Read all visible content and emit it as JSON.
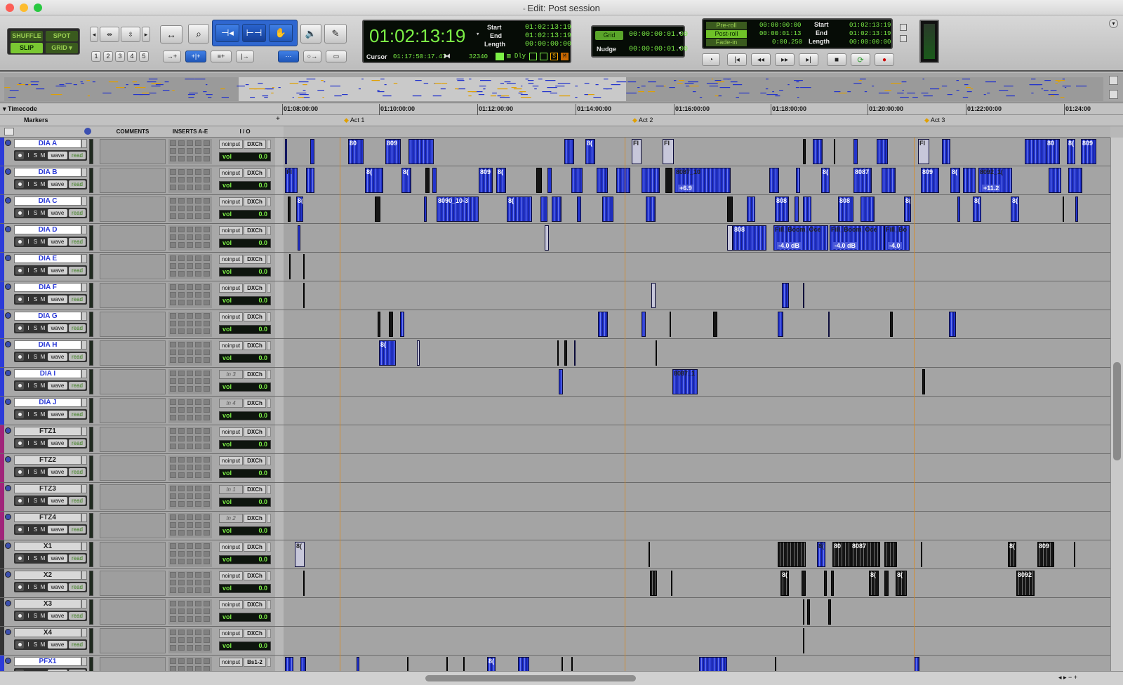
{
  "window": {
    "title": "Edit: Post session"
  },
  "toolbar": {
    "modes": [
      "SHUFFLE",
      "SPOT",
      "SLIP",
      "GRID"
    ],
    "zoom_presets": [
      "1",
      "2",
      "3",
      "4",
      "5"
    ],
    "counter": {
      "main": "01:02:13:19",
      "start_label": "Start",
      "end_label": "End",
      "length_label": "Length",
      "start": "01:02:13:19",
      "end": "01:02:13:19",
      "length": "00:00:00:00",
      "cursor_label": "Cursor",
      "cursor": "01:17:50:17.47",
      "samples": "32340",
      "dly": "Dly"
    },
    "grid": {
      "grid_label": "Grid",
      "grid_value": "00:00:00:01.00",
      "nudge_label": "Nudge",
      "nudge_value": "00:00:00:01.00"
    },
    "transport_lcd": {
      "preroll_label": "Pre-roll",
      "preroll": "00:00:00:00",
      "postroll_label": "Post-roll",
      "postroll": "00:00:01:13",
      "fadein_label": "Fade-in",
      "fadein": "0:00.250",
      "start_label": "Start",
      "start": "01:02:13:19",
      "end_label": "End",
      "end": "01:02:13:19",
      "length_label": "Length",
      "length": "00:00:00:00"
    }
  },
  "rulers": {
    "timecode_label": "Timecode",
    "markers_label": "Markers",
    "ticks": [
      "01:08:00:00",
      "01:10:00:00",
      "01:12:00:00",
      "01:14:00:00",
      "01:16:00:00",
      "01:18:00:00",
      "01:20:00:00",
      "01:22:00:00",
      "01:24:00"
    ],
    "markers": [
      "Act 1",
      "Act 2",
      "Act 3"
    ]
  },
  "columns": {
    "comments": "COMMENTS",
    "inserts": "INSERTS A-E",
    "io": "I / O"
  },
  "track_buttons": {
    "i": "I",
    "s": "S",
    "m": "M",
    "wave": "wave",
    "read": "read",
    "vol": "vol"
  },
  "tracks": [
    {
      "name": "DIA A",
      "input": "noinput",
      "output": "DXCh",
      "vol": "0.0",
      "color": "#2c3bd8"
    },
    {
      "name": "DIA B",
      "input": "noinput",
      "output": "DXCh",
      "vol": "0.0",
      "color": "#2c3bd8"
    },
    {
      "name": "DIA C",
      "input": "noinput",
      "output": "DXCh",
      "vol": "0.0",
      "color": "#2c3bd8"
    },
    {
      "name": "DIA D",
      "input": "noinput",
      "output": "DXCh",
      "vol": "0.0",
      "color": "#2c3bd8"
    },
    {
      "name": "DIA E",
      "input": "noinput",
      "output": "DXCh",
      "vol": "0.0",
      "color": "#2c3bd8"
    },
    {
      "name": "DIA F",
      "input": "noinput",
      "output": "DXCh",
      "vol": "0.0",
      "color": "#2c3bd8"
    },
    {
      "name": "DIA G",
      "input": "noinput",
      "output": "DXCh",
      "vol": "0.0",
      "color": "#2c3bd8"
    },
    {
      "name": "DIA H",
      "input": "noinput",
      "output": "DXCh",
      "vol": "0.0",
      "color": "#2c3bd8"
    },
    {
      "name": "DIA I",
      "input": "In 3",
      "output": "DXCh",
      "vol": "0.0",
      "color": "#2c3bd8"
    },
    {
      "name": "DIA J",
      "input": "In 4",
      "output": "DXCh",
      "vol": "0.0",
      "color": "#2c3bd8"
    },
    {
      "name": "FTZ1",
      "input": "noinput",
      "output": "DXCh",
      "vol": "0.0",
      "color": "#a0247a"
    },
    {
      "name": "FTZ2",
      "input": "noinput",
      "output": "DXCh",
      "vol": "0.0",
      "color": "#a0247a"
    },
    {
      "name": "FTZ3",
      "input": "In 1",
      "output": "DXCh",
      "vol": "0.0",
      "color": "#a0247a"
    },
    {
      "name": "FTZ4",
      "input": "In 2",
      "output": "DXCh",
      "vol": "0.0",
      "color": "#a0247a"
    },
    {
      "name": "X1",
      "input": "noinput",
      "output": "DXCh",
      "vol": "0.0",
      "color": "#333333"
    },
    {
      "name": "X2",
      "input": "noinput",
      "output": "DXCh",
      "vol": "0.0",
      "color": "#333333"
    },
    {
      "name": "X3",
      "input": "noinput",
      "output": "DXCh",
      "vol": "0.0",
      "color": "#333333"
    },
    {
      "name": "X4",
      "input": "noinput",
      "output": "DXCh",
      "vol": "0.0",
      "color": "#333333"
    },
    {
      "name": "PFX1",
      "input": "noinput",
      "output": "Bs1-2",
      "vol": "",
      "color": "#2c3bd8"
    }
  ],
  "clip_labels": {
    "c0": "80",
    "c1": "809",
    "c2": "8(",
    "c3": "8087_10",
    "c4": "809",
    "c5": "8092_1(",
    "c6": "8090_10-3",
    "c7": "808",
    "c8": "Fill_Boom_Oce",
    "c9": "Fill_Boom_Oce",
    "c10": "Fill_Bo",
    "c11": "8087_1",
    "c12": "8087",
    "c13": "8092",
    "c14": "FI"
  },
  "gains": {
    "g0": "+6.9",
    "g1": "+11.2",
    "g2": "-4.0 dB",
    "g3": "-4.0 dB",
    "g4": "-4.0"
  }
}
